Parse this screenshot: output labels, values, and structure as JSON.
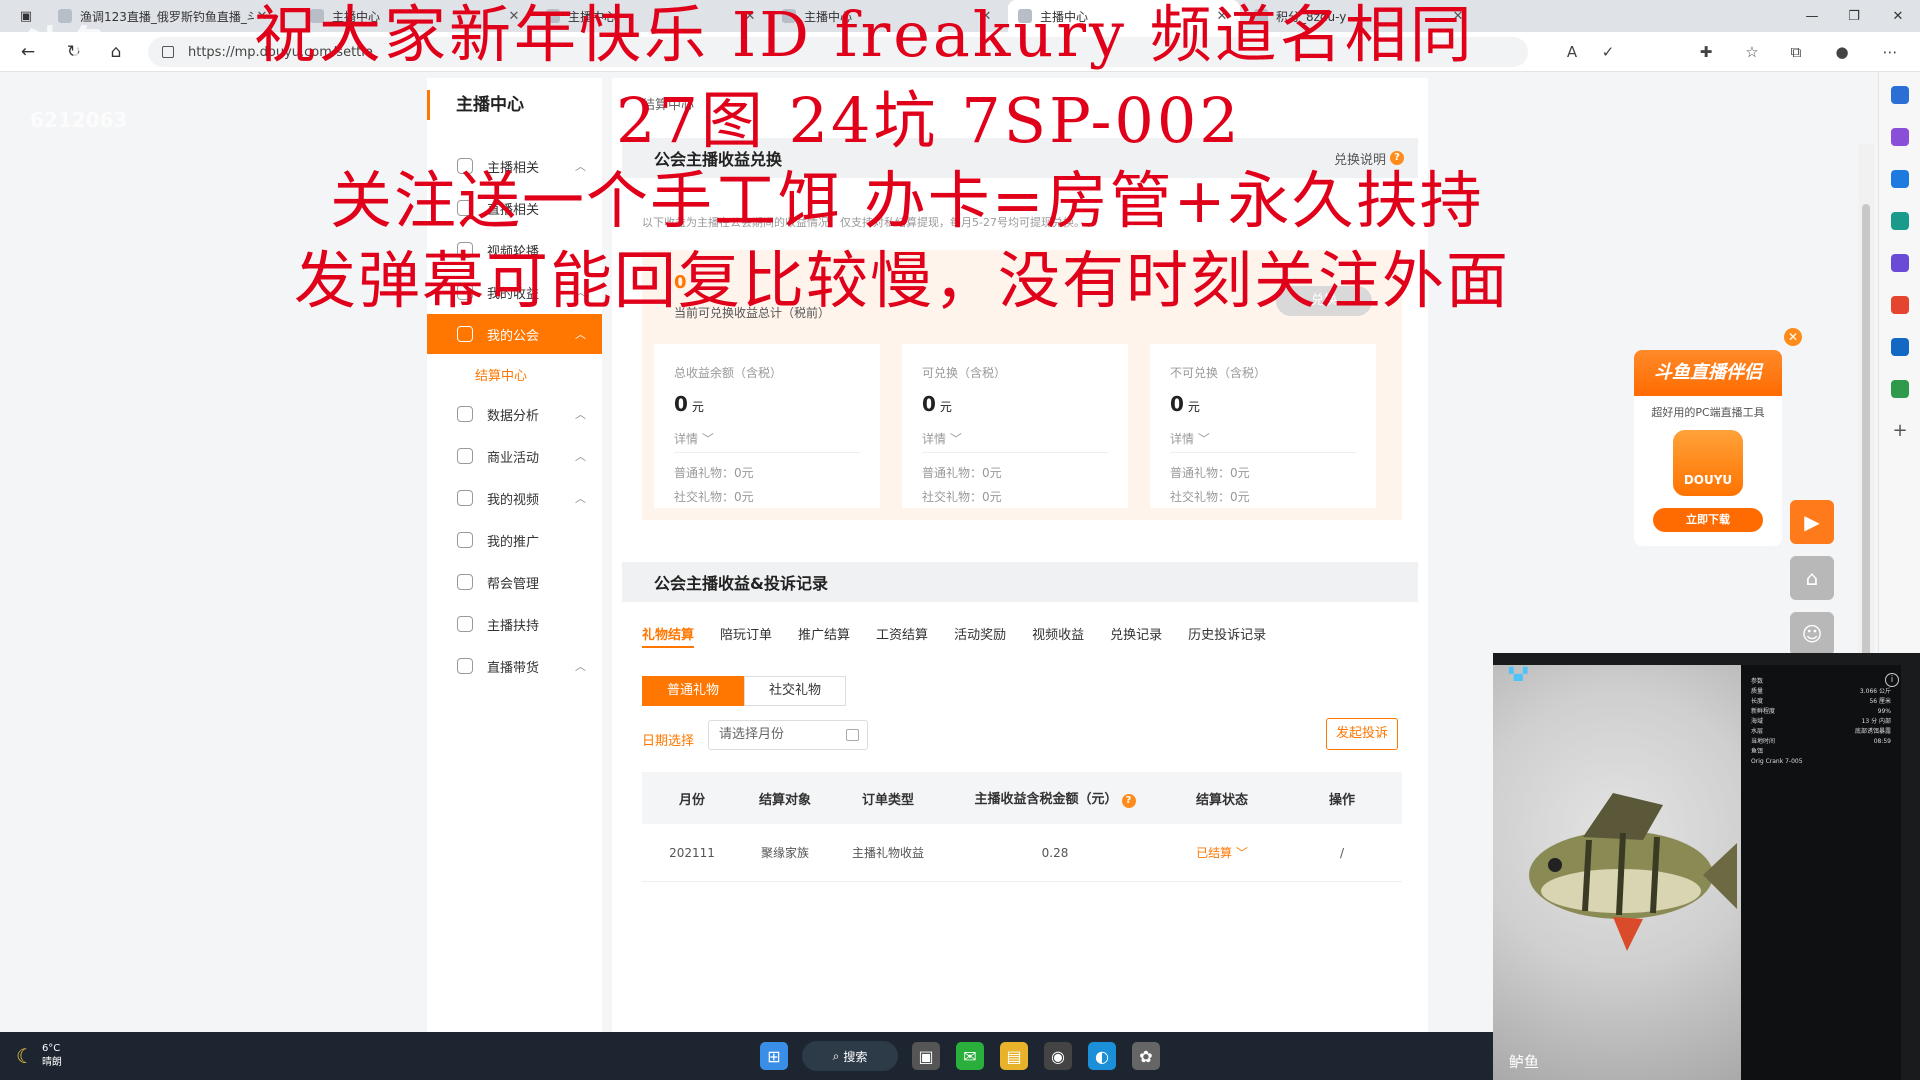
{
  "browser": {
    "tabs": [
      {
        "title": "渔调123直播_俄罗斯钓鱼直播_斗",
        "active": false
      },
      {
        "title": "主播中心",
        "active": false
      },
      {
        "title": "主播中心",
        "active": false
      },
      {
        "title": "主播中心",
        "active": false
      },
      {
        "title": "主播中心",
        "active": true
      },
      {
        "title": "积分_8zdu-y",
        "active": false
      }
    ],
    "url": "https://mp.douyu.com/settle"
  },
  "sidebar": {
    "brand": "主播中心",
    "items": [
      {
        "label": "主播相关",
        "icon": "mic-icon",
        "expandable": true
      },
      {
        "label": "直播相关",
        "icon": "video-icon",
        "expandable": false
      },
      {
        "label": "视频轮播",
        "icon": "carousel-icon",
        "expandable": false
      },
      {
        "label": "我的收益",
        "icon": "wallet-icon",
        "expandable": true
      },
      {
        "label": "我的公会",
        "icon": "shield-icon",
        "expandable": true,
        "active": true
      },
      {
        "label": "结算中心",
        "icon": "",
        "sub": true
      },
      {
        "label": "数据分析",
        "icon": "chart-icon",
        "expandable": true
      },
      {
        "label": "商业活动",
        "icon": "building-icon",
        "expandable": true
      },
      {
        "label": "我的视频",
        "icon": "film-icon",
        "expandable": true
      },
      {
        "label": "我的推广",
        "icon": "mic-icon",
        "expandable": false
      },
      {
        "label": "帮会管理",
        "icon": "gear-icon",
        "expandable": false
      },
      {
        "label": "主播扶持",
        "icon": "thumb-icon",
        "expandable": false
      },
      {
        "label": "直播带货",
        "icon": "bag-icon",
        "expandable": true
      }
    ]
  },
  "main": {
    "breadcrumb": "结算中心",
    "exchange": {
      "title": "公会主播收益兑换",
      "help": "兑换说明",
      "note": "以下收益为主播在公会期间的收益情况，仅支持对私结算提现，每月5-27号均可提现兑换。",
      "top_value": "0",
      "top_label": "当前可兑换收益总计（税前）",
      "button": "兑换",
      "cards": [
        {
          "title": "总收益余额（含税）",
          "amount": "0",
          "unit": "元",
          "detail": "详情",
          "row1": "普通礼物：0元",
          "row2": "社交礼物：0元"
        },
        {
          "title": "可兑换（含税）",
          "amount": "0",
          "unit": "元",
          "detail": "详情",
          "row1": "普通礼物：0元",
          "row2": "社交礼物：0元"
        },
        {
          "title": "不可兑换（含税）",
          "amount": "0",
          "unit": "元",
          "detail": "详情",
          "row1": "普通礼物：0元",
          "row2": "社交礼物：0元"
        }
      ]
    },
    "records": {
      "title": "公会主播收益&投诉记录",
      "tabs": [
        "礼物结算",
        "陪玩订单",
        "推广结算",
        "工资结算",
        "活动奖励",
        "视频收益",
        "兑换记录",
        "历史投诉记录"
      ],
      "segments": [
        "普通礼物",
        "社交礼物"
      ],
      "date_label": "日期选择",
      "date_placeholder": "请选择月份",
      "complain_button": "发起投诉",
      "columns": [
        "月份",
        "结算对象",
        "订单类型",
        "主播收益含税金额（元）",
        "结算状态",
        "操作"
      ],
      "rows": [
        {
          "month": "202111",
          "target": "聚缘家族",
          "type": "主播礼物收益",
          "amount": "0.28",
          "status": "已结算",
          "action": "/"
        }
      ]
    }
  },
  "ad": {
    "title": "斗鱼直播伴侣",
    "subtitle": "超好用的PC端直播工具",
    "logo_text": "DOUYU",
    "button": "立即下载"
  },
  "overlay": {
    "line1": "祝大家新年快乐  ID  freakury 频道名相同",
    "line2": "27图   24坑  7SP-002",
    "line3": "关注送一个手工饵  办卡=房管+永久扶持",
    "line4": "发弹幕可能回复比较慢，没有时刻关注外面",
    "watermark_id": "6212063"
  },
  "game": {
    "fish_name": "鲈鱼",
    "stats": [
      {
        "k": "参数",
        "v": ""
      },
      {
        "k": "质量",
        "v": "3.066 公斤"
      },
      {
        "k": "长度",
        "v": "56 厘米"
      },
      {
        "k": "新鲜程度",
        "v": "99%"
      },
      {
        "k": "海域",
        "v": "13 分 内部"
      },
      {
        "k": "水层",
        "v": "底部诱饵暴露"
      },
      {
        "k": "当地时间",
        "v": "08:59"
      },
      {
        "k": "鱼饵",
        "v": ""
      },
      {
        "k": "Orig Crank 7-005",
        "v": ""
      }
    ]
  },
  "taskbar": {
    "temp": "6°C",
    "weather": "晴朗",
    "search": "搜索"
  },
  "colors": {
    "accent": "#ff7700",
    "caption": "#e0001a"
  }
}
